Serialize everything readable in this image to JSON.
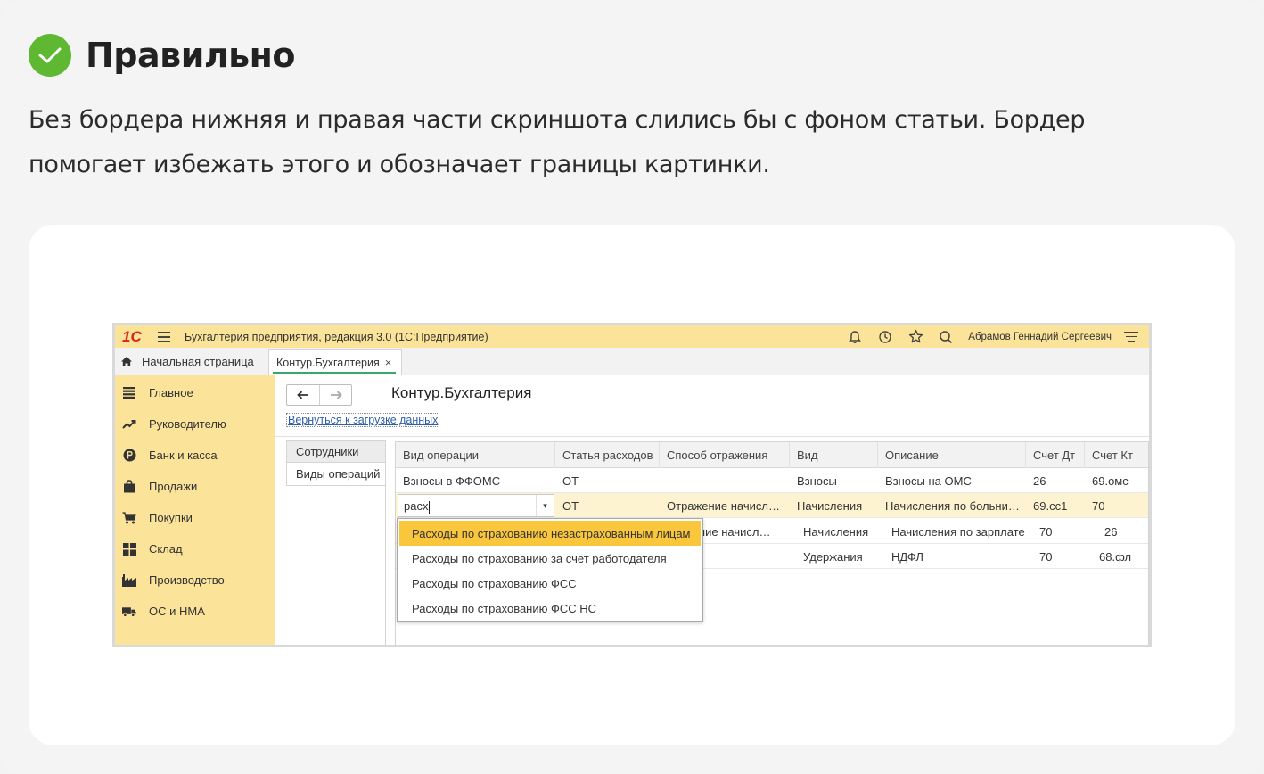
{
  "article": {
    "heading": "Правильно",
    "description": "Без бордера нижняя и правая части скриншота слились бы с фоном статьи. Бордер помогает избежать этого и обозначает границы картинки."
  },
  "colors": {
    "check": "#5fb832",
    "onec_yellow": "#fbe49a",
    "highlight": "#f9c63c"
  },
  "app": {
    "logo": "1С",
    "title": "Бухгалтерия предприятия, редакция 3.0  (1С:Предприятие)",
    "user": "Абрамов Геннадий Сергеевич",
    "toolbar_icons": [
      "bell-icon",
      "history-icon",
      "star-icon",
      "search-icon",
      "menu-icon"
    ]
  },
  "tabs": {
    "home": "Начальная страница",
    "active": "Контур.Бухгалтерия",
    "close": "×"
  },
  "sidebar": {
    "items": [
      {
        "label": "Главное",
        "icon": "menu-list-icon"
      },
      {
        "label": "Руководителю",
        "icon": "trend-icon"
      },
      {
        "label": "Банк и касса",
        "icon": "ruble-icon"
      },
      {
        "label": "Продажи",
        "icon": "bag-icon"
      },
      {
        "label": "Покупки",
        "icon": "cart-icon"
      },
      {
        "label": "Склад",
        "icon": "warehouse-icon"
      },
      {
        "label": "Производство",
        "icon": "factory-icon"
      },
      {
        "label": "ОС и НМА",
        "icon": "truck-icon"
      }
    ]
  },
  "form": {
    "title": "Контур.Бухгалтерия",
    "back_link": "Вернуться к загрузке данных",
    "subnav": [
      "Сотрудники",
      "Виды операций"
    ]
  },
  "table": {
    "columns": [
      "Вид операции",
      "Статья расходов",
      "Способ отражения",
      "Вид",
      "Описание",
      "Счет Дт",
      "Счет Кт"
    ],
    "rows": [
      {
        "op": "Взносы в ФФОМС",
        "cost": "ОТ",
        "method": "",
        "kind": "Взносы",
        "desc": "Взносы на ОМС",
        "dt": "26",
        "kt": "69.омс"
      },
      {
        "op": "расх",
        "cost": "ОТ",
        "method": "Отражение начисл…",
        "kind": "Начисления",
        "desc": "Начисления по больни…",
        "dt": "69.сс1",
        "kt": "70"
      },
      {
        "op": "",
        "cost": "",
        "method": "жение начисл…",
        "kind": "Начисления",
        "desc": "Начисления по зарплате",
        "dt": "70",
        "kt": "26"
      },
      {
        "op": "",
        "cost": "",
        "method": "",
        "kind": "Удержания",
        "desc": "НДФЛ",
        "dt": "70",
        "kt": "68.фл"
      }
    ]
  },
  "dropdown": {
    "items": [
      "Расходы по страхованию незастрахованным лицам",
      "Расходы по страхованию за счет работодателя",
      "Расходы по страхованию ФСС",
      "Расходы по страхованию ФСС НС"
    ],
    "highlighted_index": 0
  }
}
